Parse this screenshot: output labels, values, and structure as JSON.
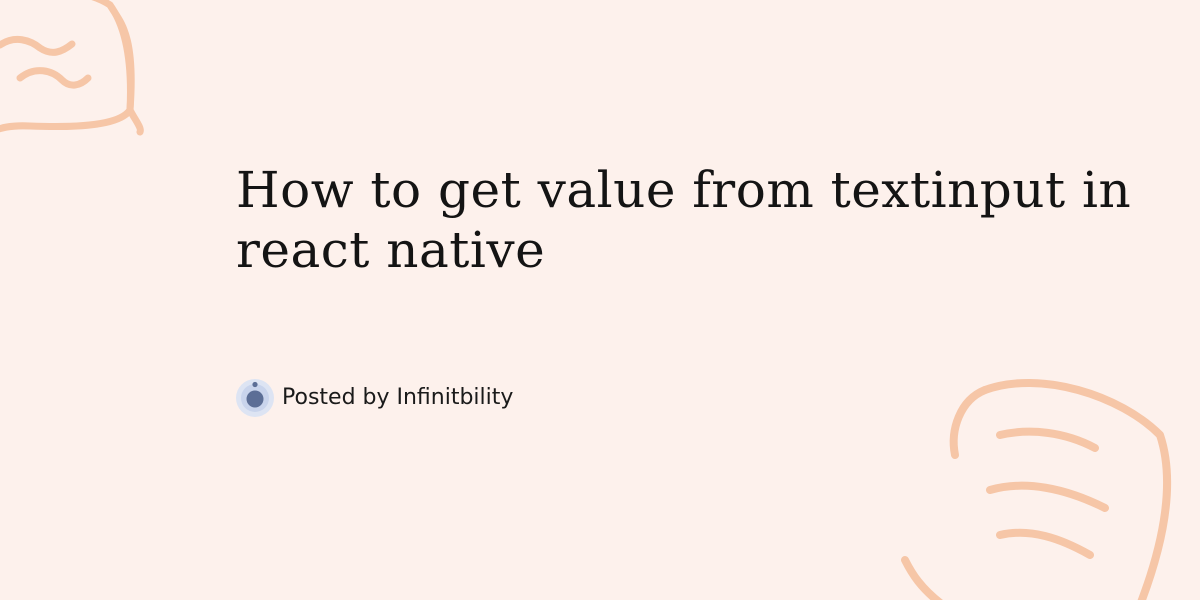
{
  "post": {
    "title": "How to get value from textinput in react native",
    "author_line": "Posted by Infinitbility"
  },
  "icons": {
    "avatar": "infinitbility-logo-icon",
    "decoration_top_left": "doodle-chat-bubble-icon",
    "decoration_bottom_right": "doodle-note-icon"
  },
  "colors": {
    "background": "#fdf1ec",
    "doodle": "#f6c6a7",
    "title_text": "#141414",
    "avatar_ring": "#c9d4ec",
    "avatar_core": "#5c6e96"
  }
}
